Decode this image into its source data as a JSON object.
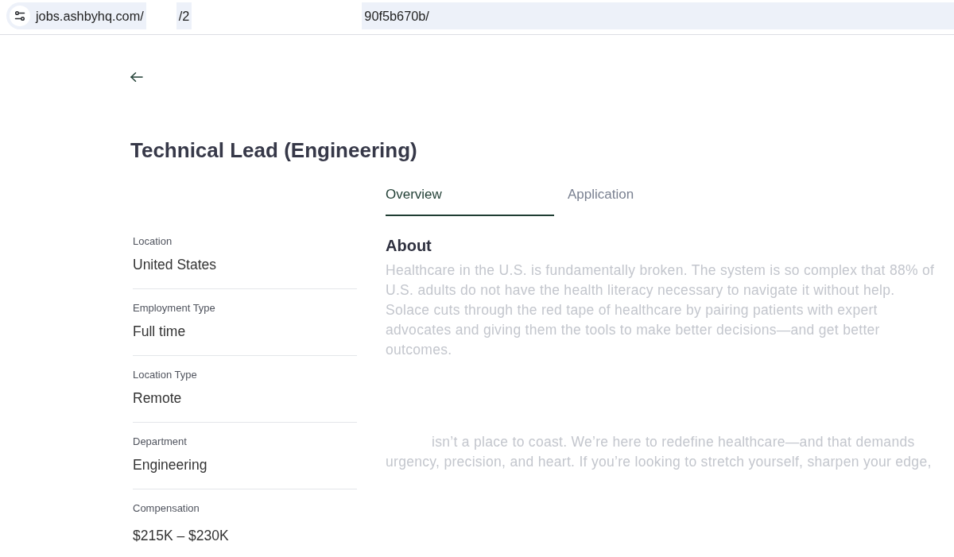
{
  "browser": {
    "url": [
      {
        "kind": "text",
        "text": "jobs.ashbyhq.com/"
      },
      {
        "kind": "redacted"
      },
      {
        "kind": "text",
        "text": "/2"
      },
      {
        "kind": "redacted"
      },
      {
        "kind": "text",
        "text": "90f5b670b/"
      }
    ]
  },
  "job": {
    "title": "Technical Lead (Engineering)"
  },
  "tabs": [
    {
      "label": "Overview",
      "selected": true
    },
    {
      "label": "Application",
      "selected": false
    }
  ],
  "details": [
    {
      "label": "Location",
      "value": "United States"
    },
    {
      "label": "Employment Type",
      "value": "Full time"
    },
    {
      "label": "Location Type",
      "value": "Remote"
    },
    {
      "label": "Department",
      "value": "Engineering"
    },
    {
      "label": "Compensation",
      "value": "$215K – $230K"
    }
  ],
  "about": {
    "heading": "About",
    "paragraphs": [
      {
        "kind": "text",
        "redacted_start": false,
        "text": "Healthcare in the U.S. is fundamentally broken. The system is so complex that 88% of U.S. adults do not have the health literacy necessary to navigate it without help. Solace cuts through the red tape of healthcare by pairing patients with expert advocates and giving them the tools to make better decisions—and get better outcomes."
      },
      {
        "kind": "redacted"
      },
      {
        "kind": "text",
        "redacted_start": true,
        "text": "isn’t a place to coast. We’re here to redefine healthcare—and that demands urgency, precision, and heart. If you’re looking to stretch yourself, sharpen your edge,"
      }
    ]
  }
}
